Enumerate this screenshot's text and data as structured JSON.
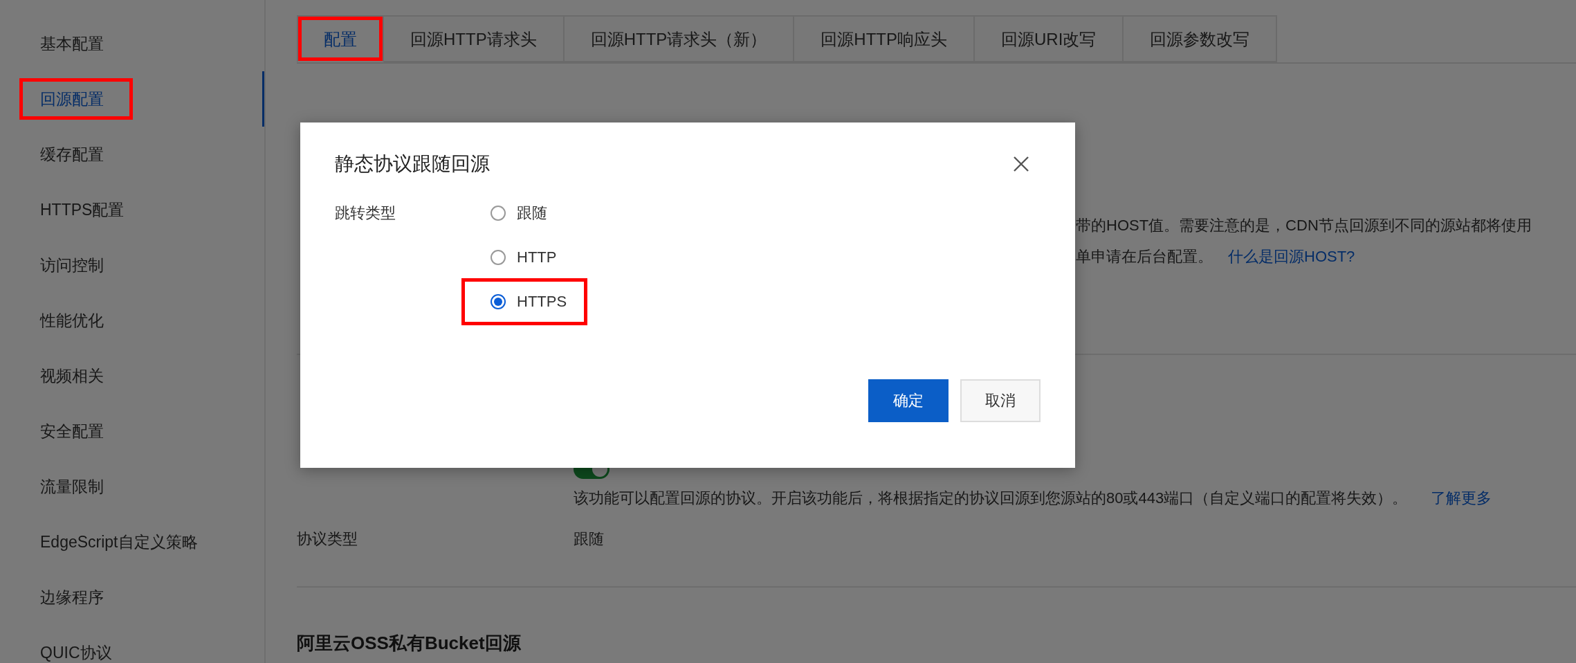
{
  "sidebar": {
    "items": [
      {
        "label": "基本配置",
        "selected": false,
        "highlighted": false
      },
      {
        "label": "回源配置",
        "selected": true,
        "highlighted": true
      },
      {
        "label": "缓存配置",
        "selected": false,
        "highlighted": false
      },
      {
        "label": "HTTPS配置",
        "selected": false,
        "highlighted": false
      },
      {
        "label": "访问控制",
        "selected": false,
        "highlighted": false
      },
      {
        "label": "性能优化",
        "selected": false,
        "highlighted": false
      },
      {
        "label": "视频相关",
        "selected": false,
        "highlighted": false
      },
      {
        "label": "安全配置",
        "selected": false,
        "highlighted": false
      },
      {
        "label": "流量限制",
        "selected": false,
        "highlighted": false
      },
      {
        "label": "EdgeScript自定义策略",
        "selected": false,
        "highlighted": false
      },
      {
        "label": "边缘程序",
        "selected": false,
        "highlighted": false
      },
      {
        "label": "QUIC协议",
        "selected": false,
        "highlighted": false
      }
    ]
  },
  "tabs": [
    {
      "label": "配置",
      "selected": true,
      "highlighted": true
    },
    {
      "label": "回源HTTP请求头",
      "selected": false,
      "highlighted": false
    },
    {
      "label": "回源HTTP请求头（新）",
      "selected": false,
      "highlighted": false
    },
    {
      "label": "回源HTTP响应头",
      "selected": false,
      "highlighted": false
    },
    {
      "label": "回源URI改写",
      "selected": false,
      "highlighted": false
    },
    {
      "label": "回源参数改写",
      "selected": false,
      "highlighted": false
    }
  ],
  "host_section": {
    "description_lines": [
      "带的HOST值。需要注意的是，CDN节点回源到不同的源站都将使用",
      "单申请在后台配置。"
    ],
    "help_link": "什么是回源HOST?"
  },
  "protocol_section": {
    "on": true,
    "description": "该功能可以配置回源的协议。开启该功能后，将根据指定的协议回源到您源站的80或443端口（自定义端口的配置将失效）。",
    "learn_more": "了解更多",
    "type_label": "协议类型",
    "type_value": "跟随"
  },
  "oss_section": {
    "title": "阿里云OSS私有Bucket回源"
  },
  "dialog": {
    "title": "静态协议跟随回源",
    "field_label": "跳转类型",
    "options": [
      {
        "label": "跟随",
        "selected": false,
        "highlighted": false
      },
      {
        "label": "HTTP",
        "selected": false,
        "highlighted": false
      },
      {
        "label": "HTTPS",
        "selected": true,
        "highlighted": true
      }
    ],
    "buttons": [
      {
        "label": "确定",
        "kind": "primary"
      },
      {
        "label": "取消",
        "kind": "secondary"
      }
    ]
  }
}
